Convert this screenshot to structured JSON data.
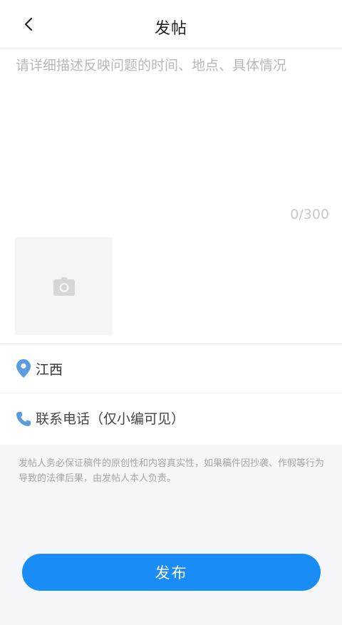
{
  "header": {
    "title": "发帖",
    "back_icon": "chevron-left-icon"
  },
  "content": {
    "placeholder": "请详细描述反映问题的时间、地点、具体情况",
    "value": "",
    "counter": "0/300"
  },
  "photo": {
    "icon": "camera-icon"
  },
  "location": {
    "icon": "location-pin-icon",
    "value": "江西",
    "icon_color": "#5b9be0"
  },
  "phone": {
    "icon": "phone-icon",
    "placeholder": "联系电话（仅小编可见）",
    "icon_color": "#5b9be0"
  },
  "notice": "发帖人务必保证稿件的原创性和内容真实性，如果稿件因抄袭、作假等行为导致的法律后果，由发帖人本人负责。",
  "publish": {
    "label": "发布",
    "color": "#1a8cf5"
  }
}
